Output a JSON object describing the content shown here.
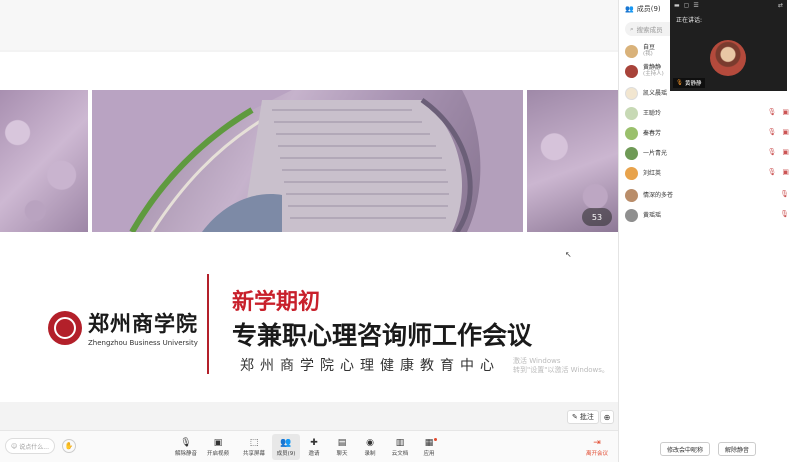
{
  "slide": {
    "badge": "53",
    "logo_cn": "郑州商学院",
    "logo_en": "Zhengzhou Business University",
    "title1": "新学期初",
    "title2": "专兼职心理咨询师工作会议",
    "title3": "郑州商学院心理健康教育中心",
    "watermark_line1": "激活 Windows",
    "watermark_line2": "转到\"设置\"以激活 Windows。"
  },
  "tools": {
    "annotate": "批注",
    "zoom_icon": "⊕"
  },
  "toolbar": {
    "chat_placeholder": "说点什么...",
    "items": [
      {
        "label": "解除静音",
        "icon": "mic-muted-icon",
        "glyph": "🎙"
      },
      {
        "label": "开启视频",
        "icon": "camera-icon",
        "glyph": "▣"
      },
      {
        "label": "共享屏幕",
        "icon": "share-screen-icon",
        "glyph": "⬚"
      },
      {
        "label": "成员(9)",
        "icon": "members-icon",
        "glyph": "👥"
      },
      {
        "label": "邀请",
        "icon": "invite-icon",
        "glyph": "✚"
      },
      {
        "label": "聊天",
        "icon": "chat-icon",
        "glyph": "▤"
      },
      {
        "label": "录制",
        "icon": "record-icon",
        "glyph": "◉"
      },
      {
        "label": "云文档",
        "icon": "document-icon",
        "glyph": "▥"
      },
      {
        "label": "应用",
        "icon": "apps-icon",
        "glyph": "▦"
      }
    ],
    "leave": "离开会议"
  },
  "panel": {
    "header": "成员(9)",
    "search_placeholder": "搜索成员",
    "members": [
      {
        "name": "自豆",
        "role": "(我)",
        "color": "#d9b27a"
      },
      {
        "name": "黄静静",
        "role": "(主持人)",
        "color": "#a8433a"
      },
      {
        "name": "凯义晨瑶",
        "role": "",
        "color": "#f2e6d0"
      },
      {
        "name": "王聪玲",
        "role": "",
        "color": "#c7d9b5"
      },
      {
        "name": "秦春芳",
        "role": "",
        "color": "#9ac06c"
      },
      {
        "name": "一片青光",
        "role": "",
        "color": "#6f9a56"
      },
      {
        "name": "刘红英",
        "role": "",
        "color": "#e8a34c"
      },
      {
        "name": "情深的多苍",
        "role": "",
        "color": "#b98d6a"
      },
      {
        "name": "黄瑶瑶",
        "role": "",
        "color": "#8f8f8f"
      }
    ],
    "buttons": {
      "rename": "修改会中昵称",
      "unmute": "解除静音"
    }
  },
  "video": {
    "speaking_label": "正在讲话:",
    "name": "黄静静"
  }
}
